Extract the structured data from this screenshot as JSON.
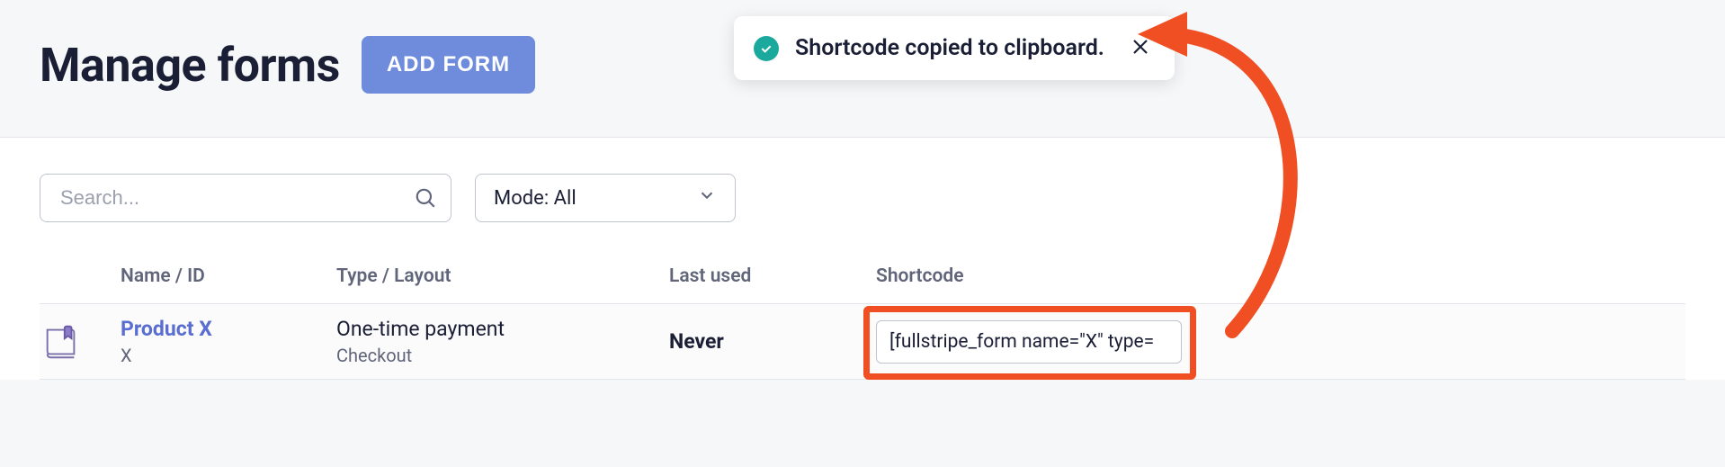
{
  "header": {
    "title": "Manage forms",
    "add_button": "ADD FORM"
  },
  "toast": {
    "message": "Shortcode copied to clipboard."
  },
  "filters": {
    "search_placeholder": "Search...",
    "mode_label": "Mode: All"
  },
  "table": {
    "columns": {
      "name": "Name / ID",
      "type": "Type / Layout",
      "last_used": "Last used",
      "shortcode": "Shortcode"
    },
    "rows": [
      {
        "name": "Product X",
        "id": "X",
        "type": "One-time payment",
        "layout": "Checkout",
        "last_used": "Never",
        "shortcode": "[fullstripe_form name=\"X\" type="
      }
    ]
  }
}
